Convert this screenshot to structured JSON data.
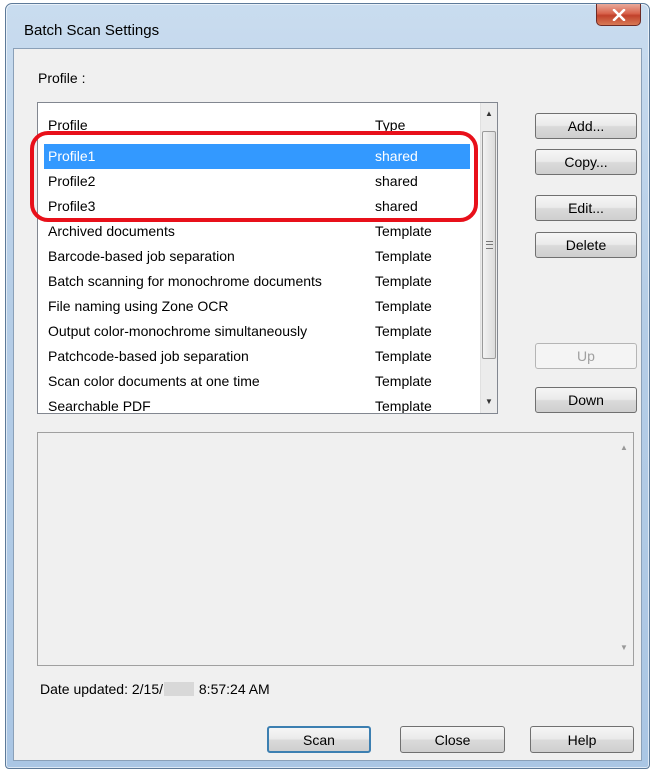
{
  "window": {
    "title": "Batch Scan Settings",
    "close_icon": "close-x-icon"
  },
  "profile_label": "Profile :",
  "list": {
    "columns": [
      "Profile",
      "Type"
    ],
    "rows": [
      {
        "name": "Profile1",
        "type": "shared",
        "selected": true
      },
      {
        "name": "Profile2",
        "type": "shared",
        "selected": false
      },
      {
        "name": "Profile3",
        "type": "shared",
        "selected": false
      },
      {
        "name": "Archived documents",
        "type": "Template",
        "selected": false
      },
      {
        "name": "Barcode-based job separation",
        "type": "Template",
        "selected": false
      },
      {
        "name": "Batch scanning for monochrome documents",
        "type": "Template",
        "selected": false
      },
      {
        "name": "File naming using Zone OCR",
        "type": "Template",
        "selected": false
      },
      {
        "name": "Output color-monochrome simultaneously",
        "type": "Template",
        "selected": false
      },
      {
        "name": "Patchcode-based job separation",
        "type": "Template",
        "selected": false
      },
      {
        "name": "Scan color documents at one time",
        "type": "Template",
        "selected": false
      },
      {
        "name": "Searchable PDF",
        "type": "Template",
        "selected": false
      }
    ],
    "selection_color": "#3399ff",
    "highlight_color": "#e8101a"
  },
  "side_buttons": {
    "add": "Add...",
    "copy": "Copy...",
    "edit": "Edit...",
    "delete": "Delete",
    "up": "Up",
    "down": "Down"
  },
  "description_text": "",
  "date_updated": {
    "label": "Date updated:",
    "date_prefix": "2/15/",
    "time": "8:57:24 AM"
  },
  "bottom_buttons": {
    "scan": "Scan",
    "close": "Close",
    "help": "Help"
  }
}
